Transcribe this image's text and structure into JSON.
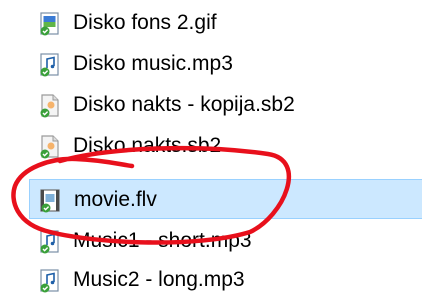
{
  "files": [
    {
      "name": "Disko fons 2.gif",
      "icon": "gif-image-file-icon"
    },
    {
      "name": "Disko music.mp3",
      "icon": "audio-file-icon"
    },
    {
      "name": "Disko nakts - kopija.sb2",
      "icon": "scratch-file-icon"
    },
    {
      "name": "Disko nakts.sb2",
      "icon": "scratch-file-icon"
    },
    {
      "name": "movie.flv",
      "icon": "video-file-icon",
      "selected": true
    },
    {
      "name": "Music1 - short.mp3",
      "icon": "audio-file-icon"
    },
    {
      "name": "Music2 - long.mp3",
      "icon": "audio-file-icon"
    }
  ],
  "colors": {
    "selection_background": "#cce8ff",
    "selection_border": "#99d1ff",
    "annotation_stroke": "#e8101c"
  }
}
